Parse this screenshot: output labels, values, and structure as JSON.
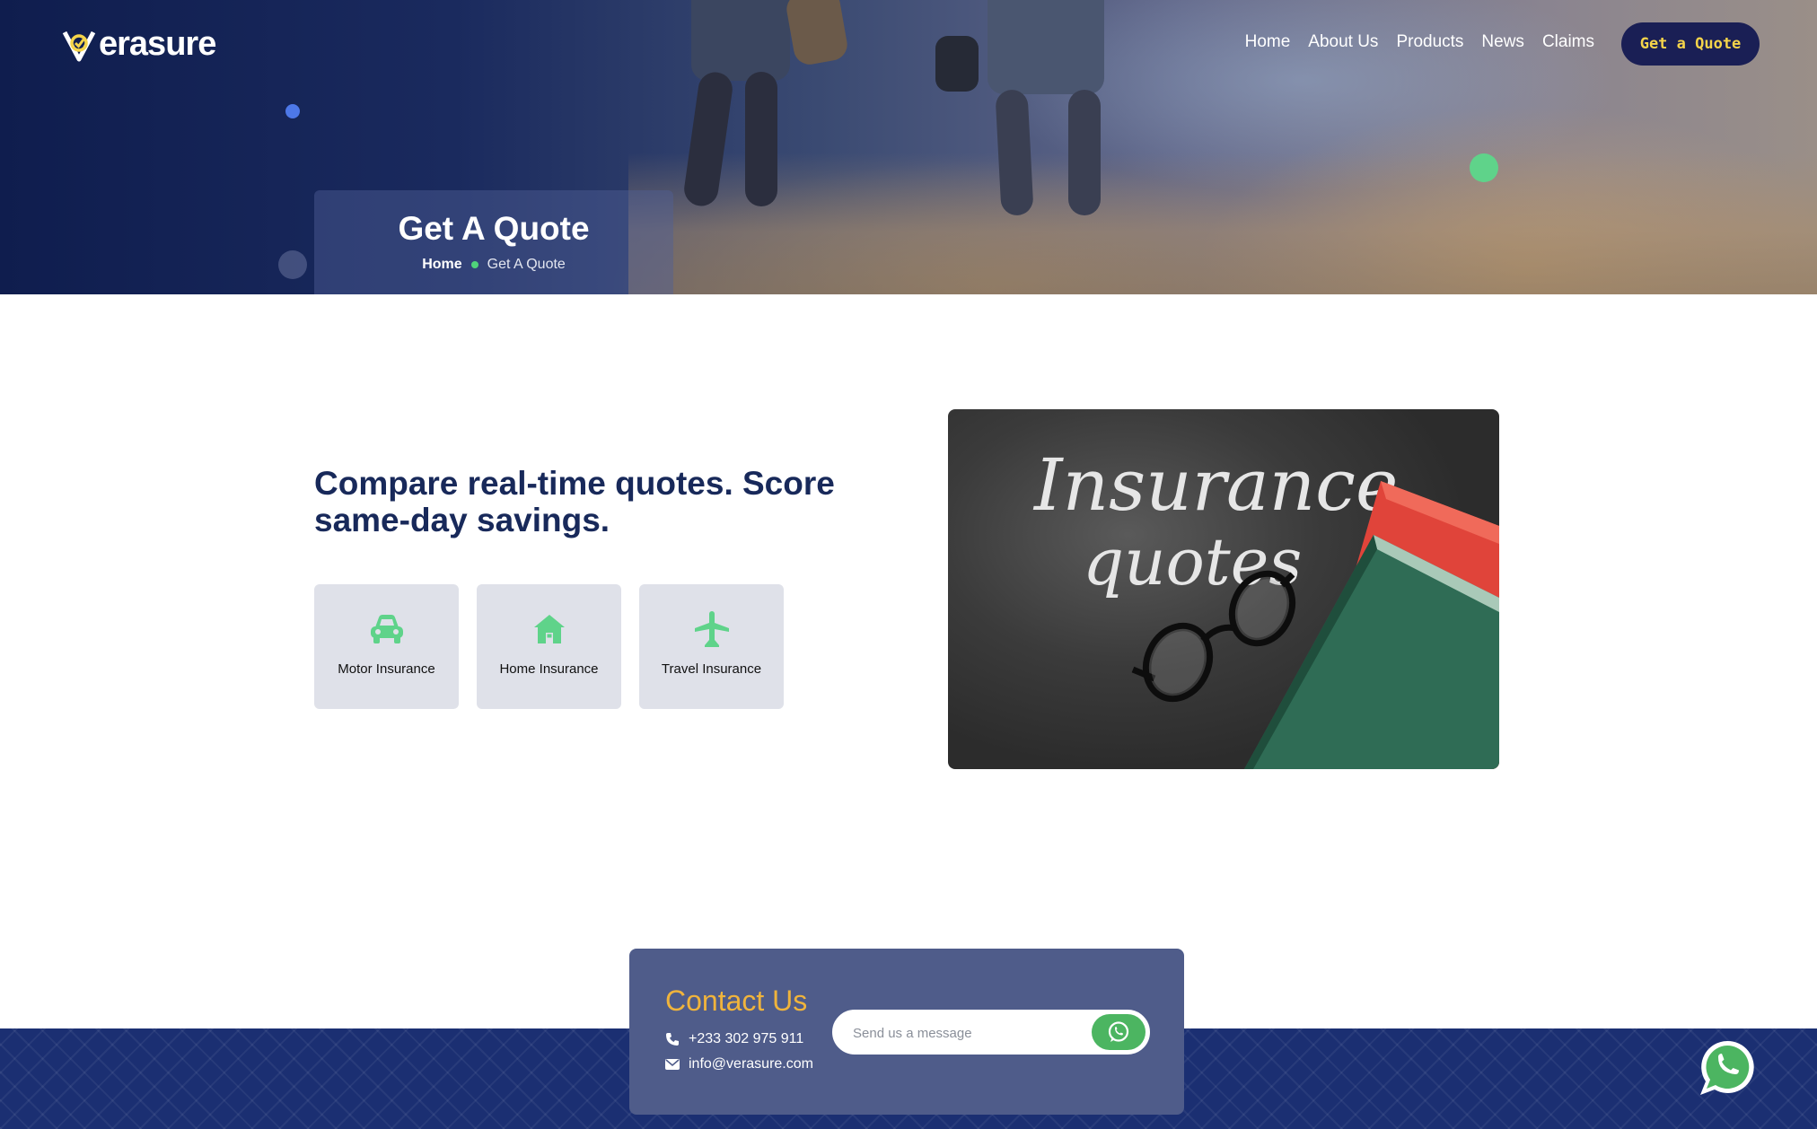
{
  "brand": {
    "name": "erasure",
    "logo_icon": "verasure-shield-check-icon"
  },
  "nav": {
    "items": [
      "Home",
      "About Us",
      "Products",
      "News",
      "Claims"
    ],
    "cta": "Get a Quote"
  },
  "hero": {
    "title": "Get A Quote",
    "breadcrumb": {
      "home": "Home",
      "current": "Get A Quote"
    }
  },
  "main": {
    "headline": "Compare real-time quotes. Score same-day savings.",
    "cards": [
      {
        "label": "Motor Insurance",
        "icon": "car-icon"
      },
      {
        "label": "Home Insurance",
        "icon": "house-icon"
      },
      {
        "label": "Travel Insurance",
        "icon": "airplane-icon"
      }
    ],
    "photo": {
      "line1": "Insurance",
      "line2": "quotes"
    }
  },
  "contact": {
    "title": "Contact Us",
    "phone": "+233 302 975 911",
    "email": "info@verasure.com",
    "message_placeholder": "Send us a message"
  },
  "colors": {
    "navy": "#18295a",
    "accent_green": "#5fd38a",
    "cta_text": "#f5d44a",
    "contact_title": "#f0b43c",
    "whatsapp": "#4cb561"
  }
}
